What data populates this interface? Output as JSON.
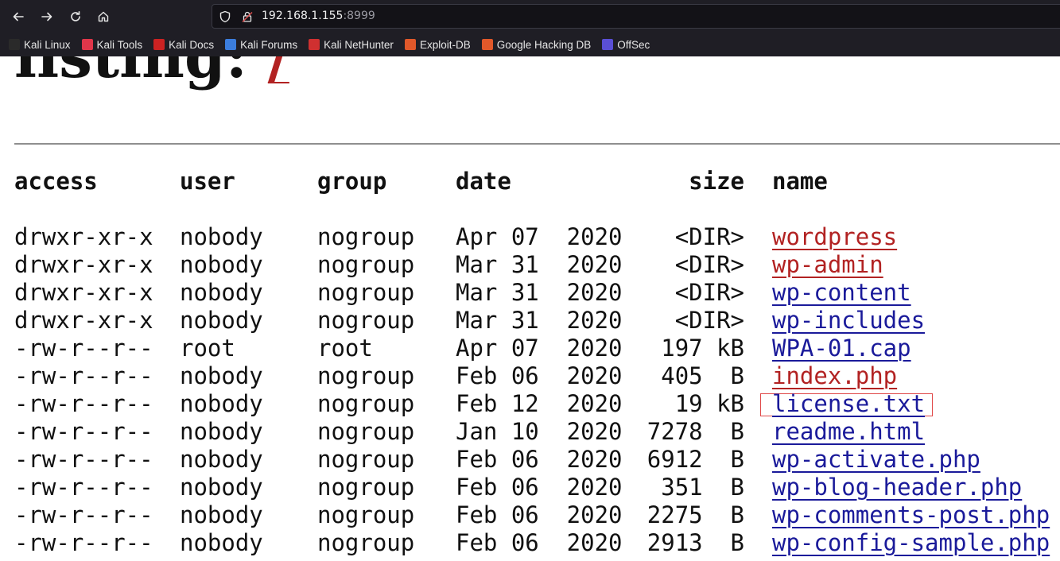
{
  "browser": {
    "url_host": "192.168.1.155",
    "url_port": ":8999",
    "bookmarks": [
      {
        "label": "Kali Linux",
        "icon": "kali-dragon-icon",
        "color": "#2a2a2a"
      },
      {
        "label": "Kali Tools",
        "icon": "kali-tools-icon",
        "color": "#e0364a"
      },
      {
        "label": "Kali Docs",
        "icon": "kali-docs-icon",
        "color": "#cc2222"
      },
      {
        "label": "Kali Forums",
        "icon": "kali-forums-icon",
        "color": "#3b7ddd"
      },
      {
        "label": "Kali NetHunter",
        "icon": "kali-nethunter-icon",
        "color": "#d03030"
      },
      {
        "label": "Exploit-DB",
        "icon": "exploit-db-icon",
        "color": "#e0582a"
      },
      {
        "label": "Google Hacking DB",
        "icon": "ghdb-icon",
        "color": "#e0582a"
      },
      {
        "label": "OffSec",
        "icon": "offsec-icon",
        "color": "#5a4fd6"
      }
    ]
  },
  "page": {
    "heading_prefix": "listing: ",
    "heading_path": "/",
    "columns": {
      "access": "access",
      "user": "user",
      "group": "group",
      "date": "date",
      "size": "size",
      "name": "name"
    },
    "rows": [
      {
        "access": "drwxr-xr-x",
        "user": "nobody",
        "group": "nogroup",
        "date": "Apr 07  2020",
        "size": "<DIR>",
        "name": "wordpress",
        "visited": true
      },
      {
        "access": "drwxr-xr-x",
        "user": "nobody",
        "group": "nogroup",
        "date": "Mar 31  2020",
        "size": "<DIR>",
        "name": "wp-admin",
        "visited": true
      },
      {
        "access": "drwxr-xr-x",
        "user": "nobody",
        "group": "nogroup",
        "date": "Mar 31  2020",
        "size": "<DIR>",
        "name": "wp-content",
        "visited": false
      },
      {
        "access": "drwxr-xr-x",
        "user": "nobody",
        "group": "nogroup",
        "date": "Mar 31  2020",
        "size": "<DIR>",
        "name": "wp-includes",
        "visited": false
      },
      {
        "access": "-rw-r--r--",
        "user": "root",
        "group": "root",
        "date": "Apr 07  2020",
        "size": "197 kB",
        "name": "WPA-01.cap",
        "visited": false
      },
      {
        "access": "-rw-r--r--",
        "user": "nobody",
        "group": "nogroup",
        "date": "Feb 06  2020",
        "size": "405  B",
        "name": "index.php",
        "visited": true
      },
      {
        "access": "-rw-r--r--",
        "user": "nobody",
        "group": "nogroup",
        "date": "Feb 12  2020",
        "size": "19 kB",
        "name": "license.txt",
        "visited": false
      },
      {
        "access": "-rw-r--r--",
        "user": "nobody",
        "group": "nogroup",
        "date": "Jan 10  2020",
        "size": "7278  B",
        "name": "readme.html",
        "visited": false
      },
      {
        "access": "-rw-r--r--",
        "user": "nobody",
        "group": "nogroup",
        "date": "Feb 06  2020",
        "size": "6912  B",
        "name": "wp-activate.php",
        "visited": false
      },
      {
        "access": "-rw-r--r--",
        "user": "nobody",
        "group": "nogroup",
        "date": "Feb 06  2020",
        "size": "351  B",
        "name": "wp-blog-header.php",
        "visited": false
      },
      {
        "access": "-rw-r--r--",
        "user": "nobody",
        "group": "nogroup",
        "date": "Feb 06  2020",
        "size": "2275  B",
        "name": "wp-comments-post.php",
        "visited": false
      },
      {
        "access": "-rw-r--r--",
        "user": "nobody",
        "group": "nogroup",
        "date": "Feb 06  2020",
        "size": "2913  B",
        "name": "wp-config-sample.php",
        "visited": false
      }
    ]
  }
}
